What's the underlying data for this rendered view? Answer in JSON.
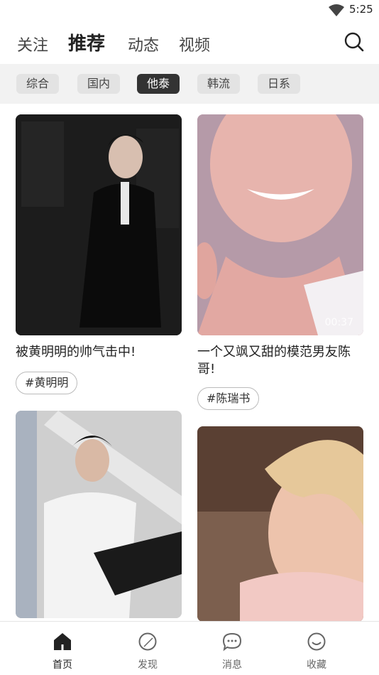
{
  "status_bar": {
    "time": "5:25"
  },
  "top_nav": {
    "tabs": [
      {
        "label": "关注"
      },
      {
        "label": "推荐",
        "active": true
      },
      {
        "label": "动态"
      },
      {
        "label": "视频"
      }
    ]
  },
  "categories": [
    {
      "label": "综合"
    },
    {
      "label": "国内"
    },
    {
      "label": "他泰",
      "active": true
    },
    {
      "label": "韩流"
    },
    {
      "label": "日系"
    }
  ],
  "feed": {
    "cards": [
      {
        "title": "被黄明明的帅气击中!",
        "tag": "#黄明明"
      },
      {
        "title_line1": "一个又飒又甜的模范男友陈",
        "title_line2": "哥!",
        "tag": "#陈瑞书",
        "duration": "00:37"
      },
      {},
      {}
    ]
  },
  "bottom_nav": {
    "items": [
      {
        "label": "首页",
        "icon": "home-icon",
        "active": true
      },
      {
        "label": "发现",
        "icon": "discover-icon"
      },
      {
        "label": "消息",
        "icon": "message-icon"
      },
      {
        "label": "收藏",
        "icon": "favorite-icon"
      }
    ]
  },
  "colors": {
    "active_chip": "#333333",
    "chip_bg": "#e3e3e3",
    "category_bar_bg": "#f2f2f2"
  }
}
